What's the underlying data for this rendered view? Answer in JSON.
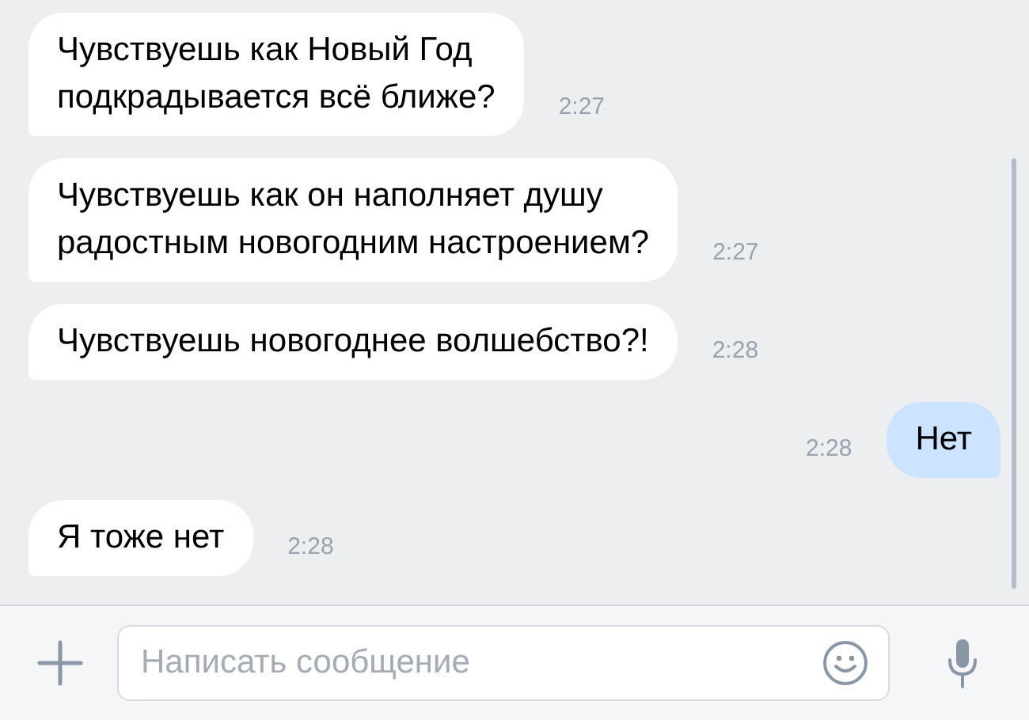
{
  "messages": [
    {
      "kind": "incoming",
      "lines": [
        "Чувствуешь как Новый Год",
        "подкрадывается всё ближе?"
      ],
      "time": "2:27"
    },
    {
      "kind": "incoming",
      "lines": [
        "Чувствуешь как он наполняет душу",
        "радостным новогодним настроением?"
      ],
      "time": "2:27"
    },
    {
      "kind": "incoming",
      "lines": [
        "Чувствуешь новогоднее волшебство?!"
      ],
      "time": "2:28"
    },
    {
      "kind": "outgoing",
      "lines": [
        "Нет"
      ],
      "time": "2:28"
    },
    {
      "kind": "incoming",
      "lines": [
        "Я тоже нет"
      ],
      "time": "2:28"
    }
  ],
  "composer": {
    "placeholder": "Написать сообщение"
  }
}
